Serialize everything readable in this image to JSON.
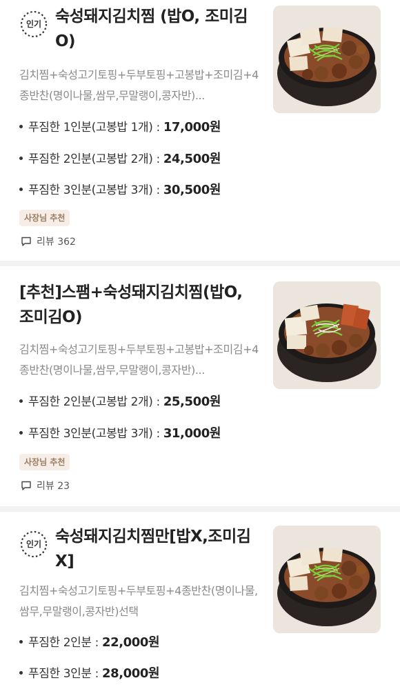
{
  "menus": [
    {
      "badge": "인기",
      "title": "숙성돼지김치찜 (밥O, 조미김O)",
      "description": "김치찜+숙성고기토핑+두부토핑+고봉밥+조미김+4종반찬(명이나물,쌈무,무말랭이,콩자반)...",
      "options": [
        {
          "label": "푸짐한 1인분(고봉밥 1개) : ",
          "price": "17,000원"
        },
        {
          "label": "푸짐한 2인분(고봉밥 2개) : ",
          "price": "24,500원"
        },
        {
          "label": "푸짐한 3인분(고봉밥 3개) : ",
          "price": "30,500원"
        }
      ],
      "tag": "사장님 추천",
      "review": "리뷰 362"
    },
    {
      "title": "[추천]스팸+숙성돼지김치찜(밥O, 조미김O)",
      "description": "김치찜+숙성고기토핑+두부토핑+고봉밥+조미김+4종반찬(명이나물,쌈무,무말랭이,콩자반)...",
      "options": [
        {
          "label": "푸짐한 2인분(고봉밥 2개) : ",
          "price": "25,500원"
        },
        {
          "label": "푸짐한 3인분(고봉밥 3개) : ",
          "price": "31,000원"
        }
      ],
      "tag": "사장님 추천",
      "review": "리뷰 23"
    },
    {
      "badge": "인기",
      "title": "숙성돼지김치찜만[밥X,조미김X]",
      "description": "김치찜+숙성고기토핑+두부토핑+4종반찬(명이나물,쌈무,무말랭이,콩자반)선택",
      "options": [
        {
          "label": "푸짐한 2인분 : ",
          "price": "22,000원"
        },
        {
          "label": "푸짐한 3인분 : ",
          "price": "28,000원"
        }
      ]
    }
  ],
  "icons": {
    "badge": "popular-badge-icon",
    "review": "speech-bubble-icon",
    "bullet": "bullet-dot-icon"
  },
  "colors": {
    "title": "#222222",
    "description": "#8a8a8a",
    "tag_background": "#f6eee6",
    "tag_text": "#9a7c61",
    "divider": "#f2f2f2"
  }
}
